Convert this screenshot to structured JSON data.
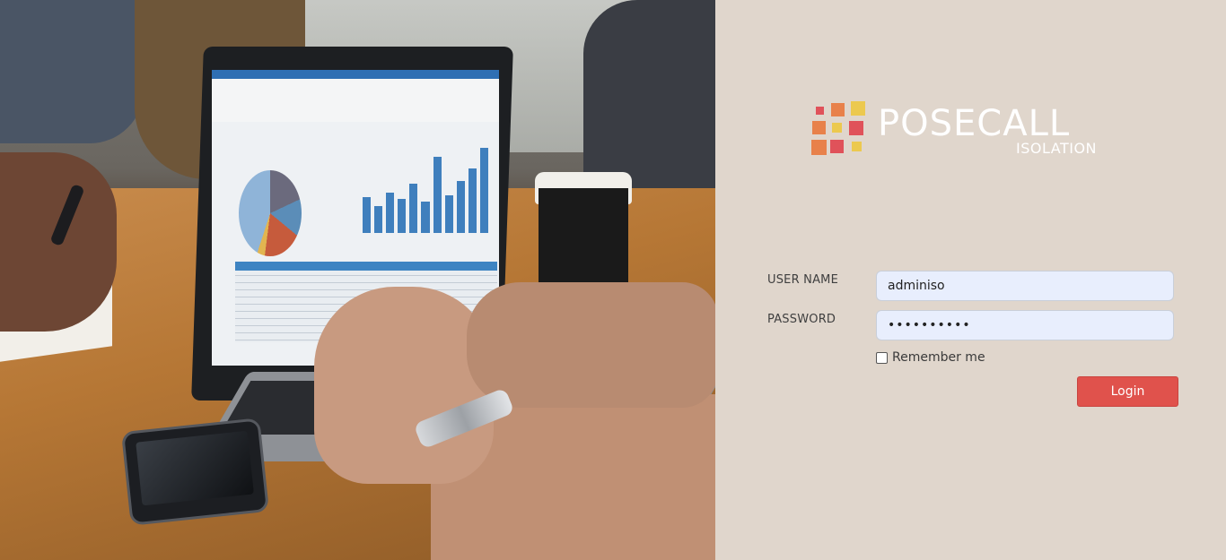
{
  "brand": {
    "title": "POSECALL",
    "subtitle": "ISOLATION",
    "colors": {
      "orange": "#e8814a",
      "red": "#e0525a",
      "yellow": "#ecc94f",
      "text": "#ffffff"
    }
  },
  "background_image": {
    "icon": "office-laptop-photo"
  },
  "form": {
    "username_label": "USER NAME",
    "username_value": "adminiso",
    "password_label": "PASSWORD",
    "password_value": "••••••••••",
    "remember_label": "Remember me",
    "remember_checked": false,
    "login_label": "Login"
  },
  "colors": {
    "panel_bg": "#e0d6cc",
    "input_bg": "#e8eefd",
    "button_bg": "#e0524c"
  }
}
